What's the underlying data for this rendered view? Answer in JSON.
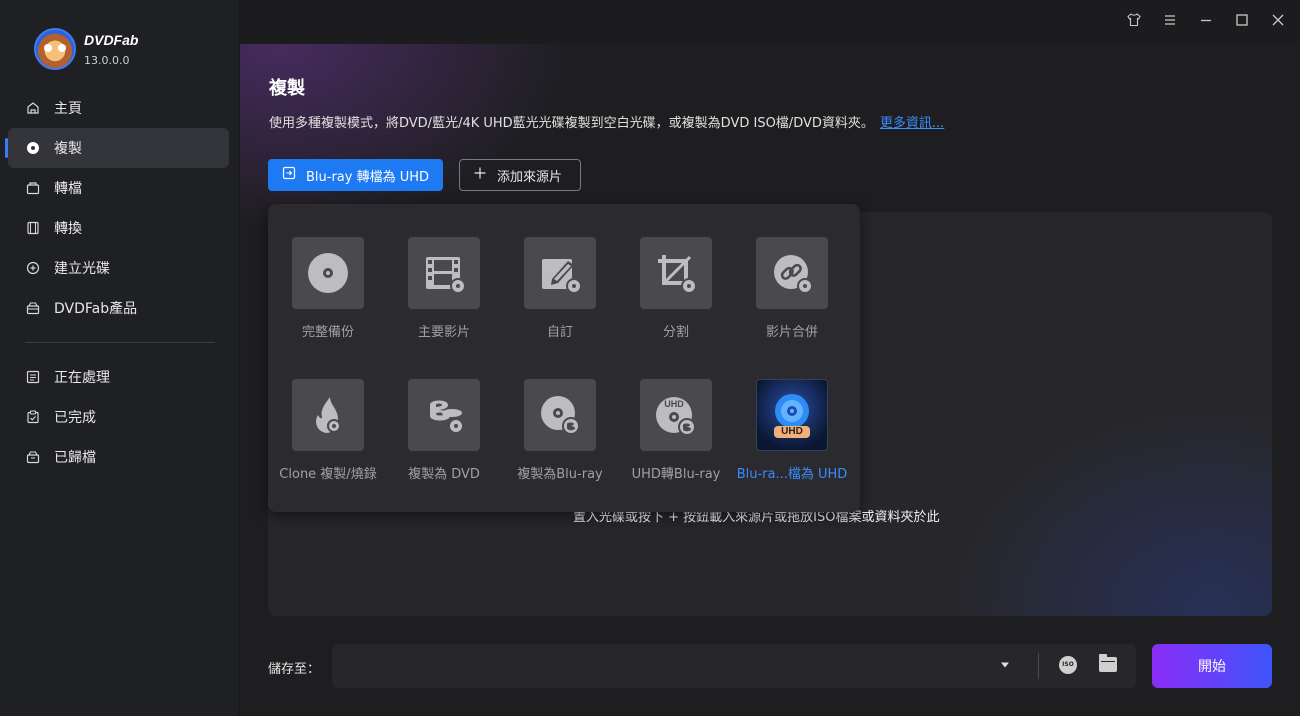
{
  "app": {
    "name": "DVDFab",
    "version": "13.0.0.0"
  },
  "sidebar": {
    "items": [
      {
        "label": "主頁",
        "icon": "home-icon",
        "active": false
      },
      {
        "label": "複製",
        "icon": "disc-copy-icon",
        "active": true
      },
      {
        "label": "轉檔",
        "icon": "rip-icon",
        "active": false
      },
      {
        "label": "轉換",
        "icon": "film-convert-icon",
        "active": false
      },
      {
        "label": "建立光碟",
        "icon": "create-disc-icon",
        "active": false
      },
      {
        "label": "DVDFab產品",
        "icon": "products-box-icon",
        "active": false
      }
    ],
    "queue_items": [
      {
        "label": "正在處理",
        "icon": "processing-list-icon"
      },
      {
        "label": "已完成",
        "icon": "completed-clipboard-icon"
      },
      {
        "label": "已歸檔",
        "icon": "archive-box-icon"
      }
    ]
  },
  "titlebar": {
    "buttons": [
      "skin-icon",
      "menu-icon",
      "minimize-icon",
      "maximize-icon",
      "close-icon"
    ]
  },
  "main": {
    "title": "複製",
    "description": "使用多種複製模式，將DVD/藍光/4K UHD藍光光碟複製到空白光碟，或複製為DVD ISO檔/DVD資料夾。",
    "more_link": "更多資訊...",
    "mode_button_label": "Blu-ray 轉檔為 UHD",
    "add_source_label": "添加來源片",
    "drop_hint": "置入光碟或按下 + 按鈕載入來源片或拖放ISO檔案或資料夾於此"
  },
  "modes": [
    {
      "label": "完整備份",
      "icon": "full-disc-icon"
    },
    {
      "label": "主要影片",
      "icon": "main-movie-film-icon"
    },
    {
      "label": "自訂",
      "icon": "customize-edit-icon"
    },
    {
      "label": "分割",
      "icon": "split-crop-icon"
    },
    {
      "label": "影片合併",
      "icon": "merge-link-icon"
    },
    {
      "label": "Clone 複製/燒錄",
      "icon": "clone-burn-flame-icon"
    },
    {
      "label": "複製為 DVD",
      "icon": "bluray-to-dvd-icon"
    },
    {
      "label": "複製為Blu-ray",
      "icon": "to-bluray-disc-icon"
    },
    {
      "label": "UHD轉Blu-ray",
      "icon": "uhd-to-bluray-icon"
    },
    {
      "label": "Blu-ra...檔為 UHD",
      "icon": "bluray-to-uhd-icon",
      "selected": true,
      "badge": "UHD"
    }
  ],
  "savebar": {
    "label": "儲存至：",
    "value": "",
    "iso_label": "ISO",
    "start_label": "開始"
  },
  "colors": {
    "accent": "#1d7af3",
    "link": "#3b8bff",
    "start_gradient_from": "#8a2cf6",
    "start_gradient_to": "#3f55fb"
  }
}
